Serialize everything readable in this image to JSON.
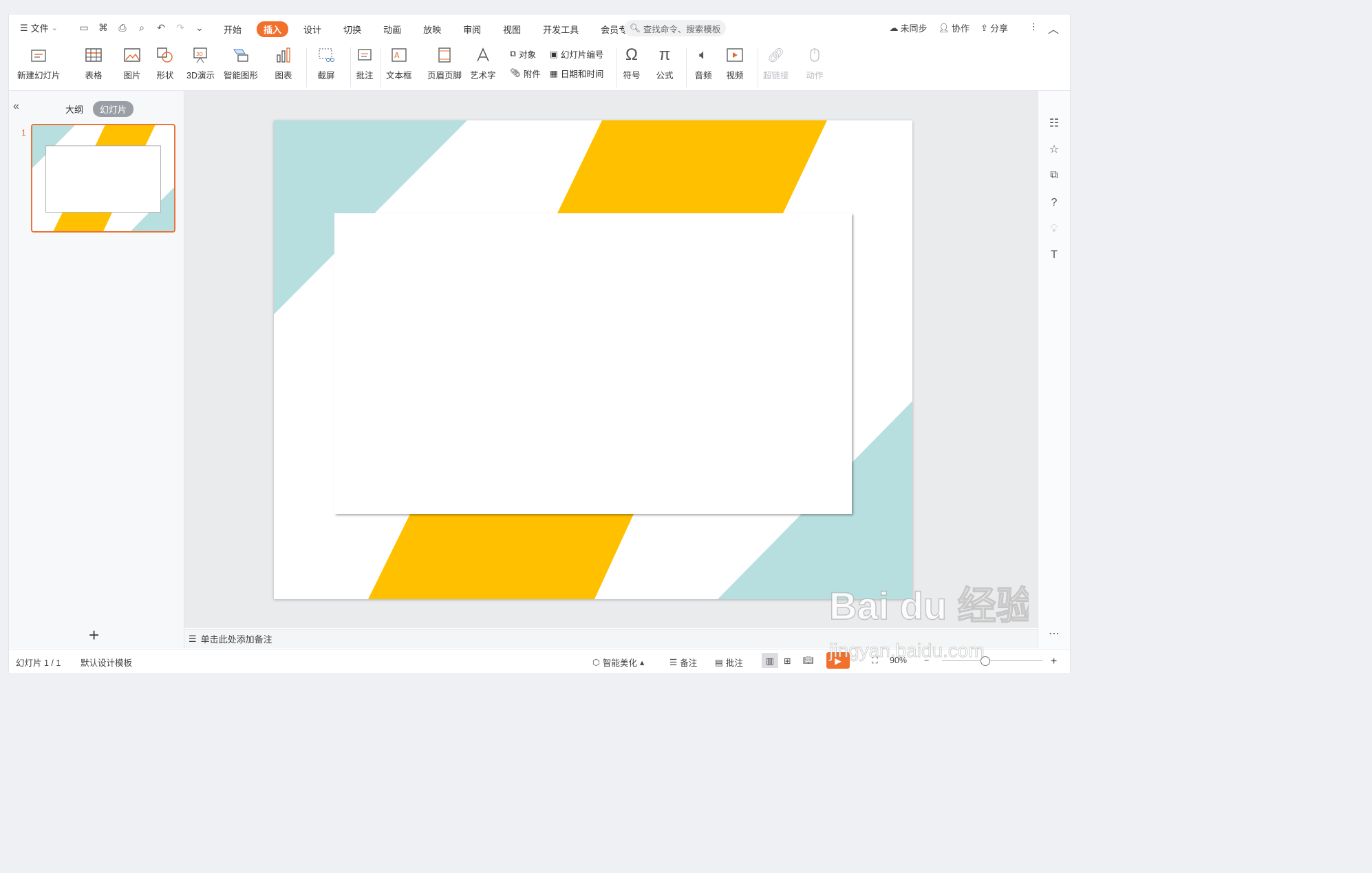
{
  "menu": {
    "label": "文件"
  },
  "tabs": [
    {
      "label": "开始"
    },
    {
      "label": "插入",
      "active": true
    },
    {
      "label": "设计"
    },
    {
      "label": "切换"
    },
    {
      "label": "动画"
    },
    {
      "label": "放映"
    },
    {
      "label": "审阅"
    },
    {
      "label": "视图"
    },
    {
      "label": "开发工具"
    },
    {
      "label": "会员专享"
    }
  ],
  "search": {
    "placeholder": "查找命令、搜索模板"
  },
  "actions": {
    "sync": "未同步",
    "collab": "协作",
    "share": "分享"
  },
  "ribbon": {
    "new_slide": "新建幻灯片",
    "table": "表格",
    "picture": "图片",
    "shape": "形状",
    "demo3d": "3D演示",
    "smartart": "智能图形",
    "chart": "图表",
    "screenshot": "截屏",
    "comment": "批注",
    "textbox": "文本框",
    "header_footer": "页眉页脚",
    "wordart": "艺术字",
    "object": "对象",
    "attachment": "附件",
    "slide_number": "幻灯片编号",
    "datetime": "日期和时间",
    "symbol": "符号",
    "formula": "公式",
    "audio": "音频",
    "video": "视频",
    "hyperlink": "超链接",
    "action": "动作"
  },
  "panel": {
    "outline": "大纲",
    "slides": "幻灯片",
    "thumb_number": "1"
  },
  "notes": {
    "placeholder": "单击此处添加备注"
  },
  "status": {
    "slide_count": "幻灯片 1 / 1",
    "template": "默认设计模板",
    "beautify": "智能美化",
    "notes": "备注",
    "comment": "批注",
    "zoom": "90%"
  },
  "watermark": {
    "text": "Bai du 经验",
    "url": "jingyan.baidu.com"
  },
  "colors": {
    "accent": "#f36f2c",
    "teal": "#b8dfe0",
    "yellow": "#ffc000"
  }
}
